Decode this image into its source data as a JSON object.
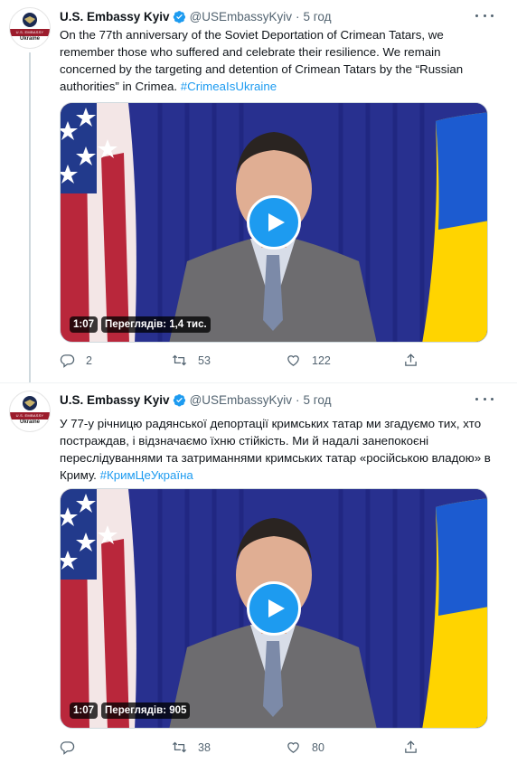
{
  "colors": {
    "accent": "#1d9bf0",
    "secondary_text": "#536471",
    "text": "#0f1419"
  },
  "tweets": [
    {
      "author_name": "U.S. Embassy Kyiv",
      "handle": "@USEmbassyKyiv",
      "separator": "·",
      "time": "5 год",
      "avatar": {
        "band_text": "U.S. EMBASSY",
        "country": "Ukraine"
      },
      "text": "On the 77th anniversary of the Soviet Deportation of Crimean Tatars, we remember those who suffered and celebrate their resilience. We remain concerned by the targeting and detention of Crimean Tatars by the “Russian authorities” in Crimea.",
      "hashtag": "#CrimeaIsUkraine",
      "video": {
        "duration": "1:07",
        "views": "Переглядів: 1,4 тис."
      },
      "replies": "2",
      "retweets": "53",
      "likes": "122"
    },
    {
      "author_name": "U.S. Embassy Kyiv",
      "handle": "@USEmbassyKyiv",
      "separator": "·",
      "time": "5 год",
      "avatar": {
        "band_text": "U.S. EMBASSY",
        "country": "Ukraine"
      },
      "text": "У 77-у річницю радянської депортації кримських татар ми згадуємо тих, хто постраждав, і відзначаємо їхню стійкість. Ми й надалі занепокоєні переслідуваннями та затриманнями кримських татар «російською владою» в Криму.",
      "hashtag": "#КримЦеУкраїна",
      "video": {
        "duration": "1:07",
        "views": "Переглядів: 905"
      },
      "replies": "",
      "retweets": "38",
      "likes": "80"
    }
  ]
}
